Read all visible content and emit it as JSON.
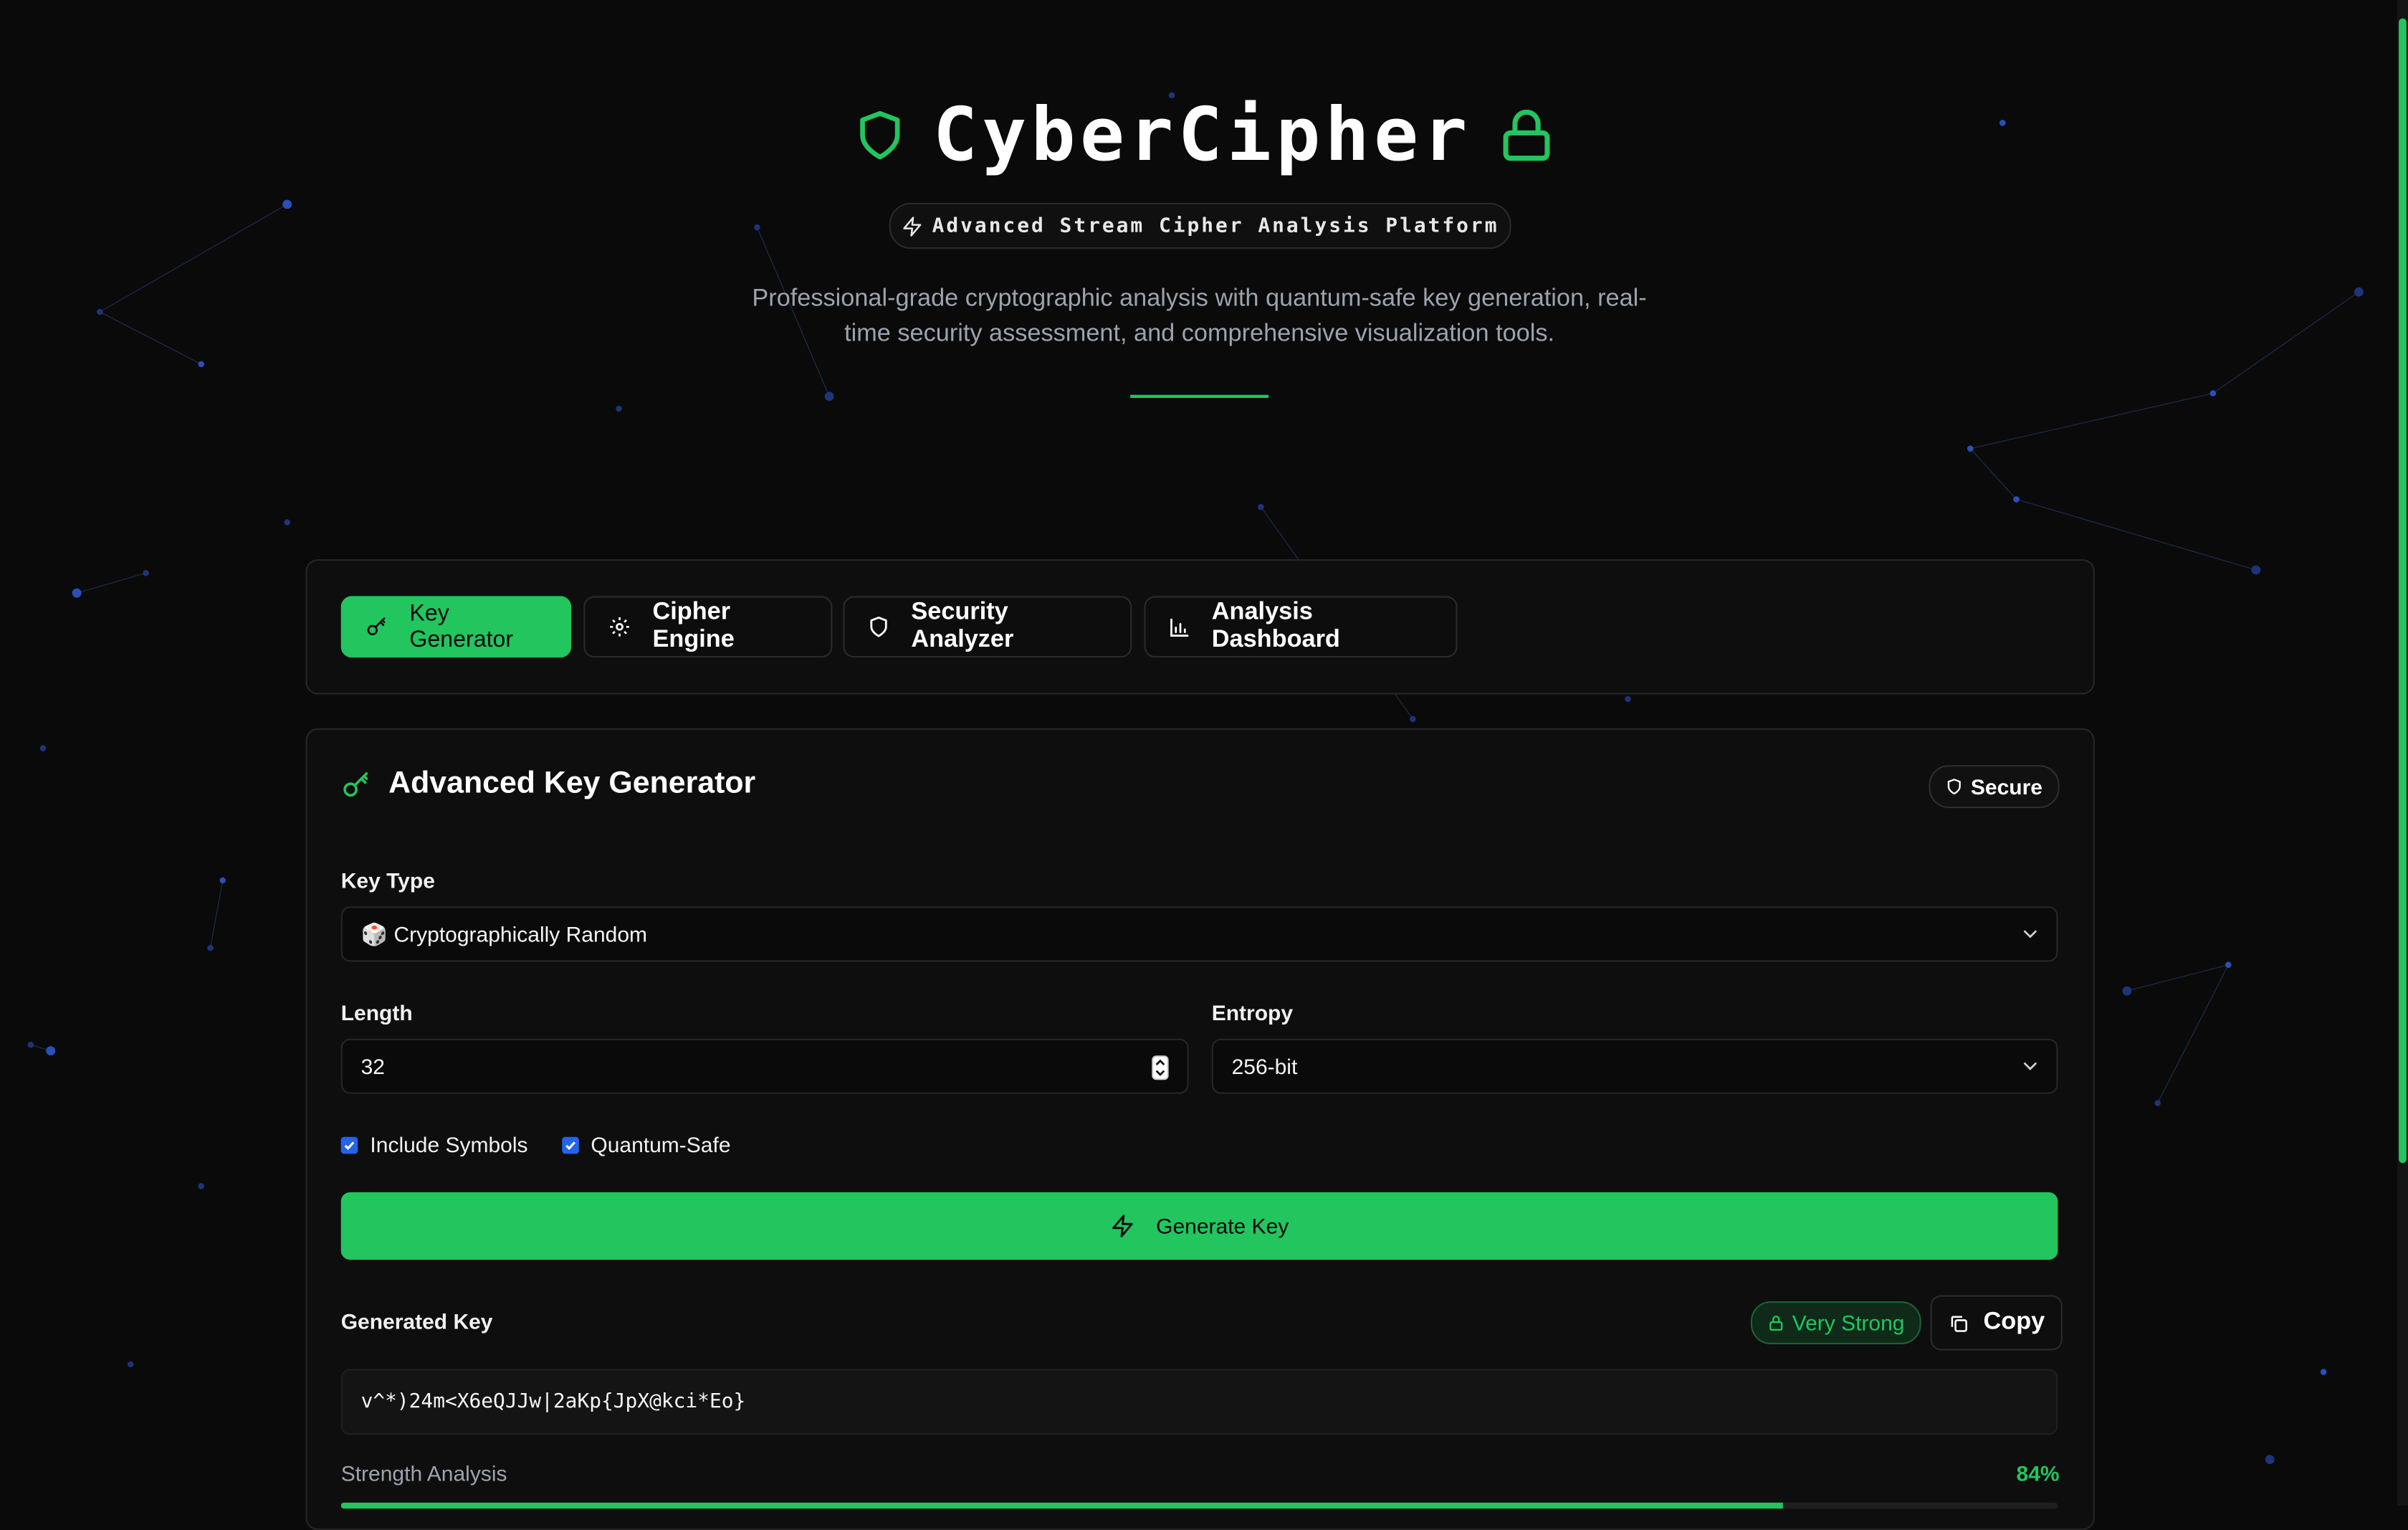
{
  "header": {
    "title": "CyberCipher",
    "tagline": "Advanced Stream Cipher Analysis Platform",
    "subtitle": "Professional-grade cryptographic analysis with quantum-safe key generation, real-time security assessment, and comprehensive visualization tools."
  },
  "tabs": [
    {
      "label": "Key Generator",
      "icon": "key-icon",
      "active": true
    },
    {
      "label": "Cipher Engine",
      "icon": "gear-icon",
      "active": false
    },
    {
      "label": "Security Analyzer",
      "icon": "shield-icon",
      "active": false
    },
    {
      "label": "Analysis Dashboard",
      "icon": "bar-chart-icon",
      "active": false
    }
  ],
  "generator": {
    "title": "Advanced Key Generator",
    "badge": "Secure",
    "key_type_label": "Key Type",
    "key_type_emoji": "🎲",
    "key_type_value": "Cryptographically Random",
    "length_label": "Length",
    "length_value": "32",
    "entropy_label": "Entropy",
    "entropy_value": "256-bit",
    "include_symbols_label": "Include Symbols",
    "include_symbols_checked": true,
    "quantum_safe_label": "Quantum-Safe",
    "quantum_safe_checked": true,
    "generate_label": "Generate Key",
    "generated_key_label": "Generated Key",
    "strength_badge": "Very Strong",
    "copy_label": "Copy",
    "generated_key": "v^*)24m<X6eQJJw|2aKp{JpX@kci*Eo}",
    "strength_label": "Strength Analysis",
    "strength_text": "84%",
    "strength_value": 0.84
  },
  "colors": {
    "accent": "#22c55e",
    "background": "#0a0a0a",
    "checkbox": "#2563eb"
  }
}
